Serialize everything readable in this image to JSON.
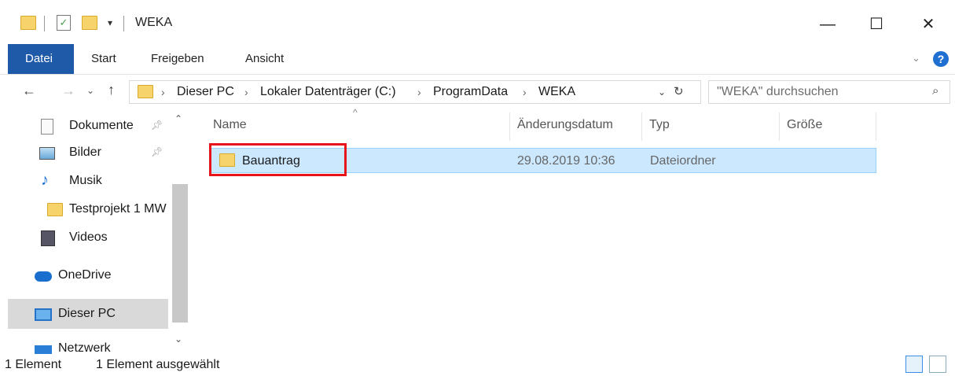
{
  "window": {
    "title": "WEKA",
    "minimize": "—",
    "maximize": "☐",
    "close": "✕"
  },
  "ribbon": {
    "tabs": [
      "Datei",
      "Start",
      "Freigeben",
      "Ansicht"
    ],
    "help": "?"
  },
  "address": {
    "crumbs": [
      "Dieser PC",
      "Lokaler Datenträger (C:)",
      "ProgramData",
      "WEKA"
    ],
    "separator": "›",
    "search_placeholder": "\"WEKA\" durchsuchen"
  },
  "sidebar": {
    "items": [
      {
        "label": "Dokumente",
        "icon": "document-icon",
        "pinned": true
      },
      {
        "label": "Bilder",
        "icon": "pictures-icon",
        "pinned": true
      },
      {
        "label": "Musik",
        "icon": "music-icon",
        "pinned": false
      },
      {
        "label": "Testprojekt 1 MW",
        "icon": "folder-icon",
        "pinned": false
      },
      {
        "label": "Videos",
        "icon": "videos-icon",
        "pinned": false
      },
      {
        "label": "OneDrive",
        "icon": "onedrive-icon",
        "pinned": false
      },
      {
        "label": "Dieser PC",
        "icon": "this-pc-icon",
        "pinned": false,
        "selected": true
      },
      {
        "label": "Netzwerk",
        "icon": "network-icon",
        "pinned": false
      }
    ]
  },
  "filelist": {
    "columns": [
      "Name",
      "Änderungsdatum",
      "Typ",
      "Größe"
    ],
    "rows": [
      {
        "name": "Bauantrag",
        "date": "29.08.2019 10:36",
        "type": "Dateiordner",
        "size": ""
      }
    ]
  },
  "status": {
    "count": "1 Element",
    "selected": "1 Element ausgewählt"
  },
  "colors": {
    "accent": "#1e5aa8",
    "selection": "#cce8ff",
    "highlight_box": "#e8141b"
  }
}
